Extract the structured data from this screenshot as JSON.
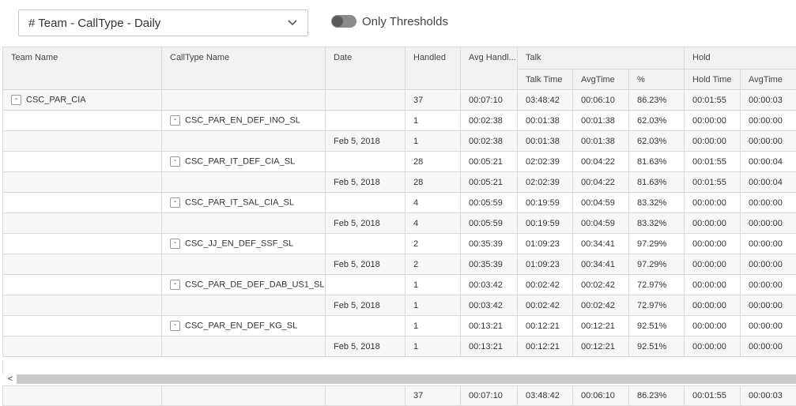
{
  "report_selector": {
    "value": "# Team - CallType - Daily"
  },
  "threshold_toggle": {
    "label": "Only Thresholds",
    "on": false
  },
  "table": {
    "headers": {
      "team_name": "Team Name",
      "calltype_name": "CallType Name",
      "date": "Date",
      "handled": "Handled",
      "avg_handle": "Avg Handl...",
      "talk_group": "Talk",
      "talk_time": "Talk Time",
      "talk_avgtime": "AvgTime",
      "talk_pct": "%",
      "hold_group": "Hold",
      "hold_time": "Hold Time",
      "hold_avgtime": "AvgTime"
    },
    "rows": [
      {
        "team": "CSC_PAR_CIA",
        "calltype": "",
        "date": "",
        "handled": "37",
        "avg_handle": "00:07:10",
        "talk_time": "03:48:42",
        "talk_avg": "00:06:10",
        "talk_pct": "86.23%",
        "hold_time": "00:01:55",
        "hold_avg": "00:00:03"
      },
      {
        "team": "",
        "calltype": "CSC_PAR_EN_DEF_INO_SL",
        "date": "",
        "handled": "1",
        "avg_handle": "00:02:38",
        "talk_time": "00:01:38",
        "talk_avg": "00:01:38",
        "talk_pct": "62.03%",
        "hold_time": "00:00:00",
        "hold_avg": "00:00:00"
      },
      {
        "team": "",
        "calltype": "",
        "date": "Feb 5, 2018",
        "handled": "1",
        "avg_handle": "00:02:38",
        "talk_time": "00:01:38",
        "talk_avg": "00:01:38",
        "talk_pct": "62.03%",
        "hold_time": "00:00:00",
        "hold_avg": "00:00:00"
      },
      {
        "team": "",
        "calltype": "CSC_PAR_IT_DEF_CIA_SL",
        "date": "",
        "handled": "28",
        "avg_handle": "00:05:21",
        "talk_time": "02:02:39",
        "talk_avg": "00:04:22",
        "talk_pct": "81.63%",
        "hold_time": "00:01:55",
        "hold_avg": "00:00:04"
      },
      {
        "team": "",
        "calltype": "",
        "date": "Feb 5, 2018",
        "handled": "28",
        "avg_handle": "00:05:21",
        "talk_time": "02:02:39",
        "talk_avg": "00:04:22",
        "talk_pct": "81.63%",
        "hold_time": "00:01:55",
        "hold_avg": "00:00:04"
      },
      {
        "team": "",
        "calltype": "CSC_PAR_IT_SAL_CIA_SL",
        "date": "",
        "handled": "4",
        "avg_handle": "00:05:59",
        "talk_time": "00:19:59",
        "talk_avg": "00:04:59",
        "talk_pct": "83.32%",
        "hold_time": "00:00:00",
        "hold_avg": "00:00:00"
      },
      {
        "team": "",
        "calltype": "",
        "date": "Feb 5, 2018",
        "handled": "4",
        "avg_handle": "00:05:59",
        "talk_time": "00:19:59",
        "talk_avg": "00:04:59",
        "talk_pct": "83.32%",
        "hold_time": "00:00:00",
        "hold_avg": "00:00:00"
      },
      {
        "team": "",
        "calltype": "CSC_JJ_EN_DEF_SSF_SL",
        "date": "",
        "handled": "2",
        "avg_handle": "00:35:39",
        "talk_time": "01:09:23",
        "talk_avg": "00:34:41",
        "talk_pct": "97.29%",
        "hold_time": "00:00:00",
        "hold_avg": "00:00:00"
      },
      {
        "team": "",
        "calltype": "",
        "date": "Feb 5, 2018",
        "handled": "2",
        "avg_handle": "00:35:39",
        "talk_time": "01:09:23",
        "talk_avg": "00:34:41",
        "talk_pct": "97.29%",
        "hold_time": "00:00:00",
        "hold_avg": "00:00:00"
      },
      {
        "team": "",
        "calltype": "CSC_PAR_DE_DEF_DAB_US1_SL",
        "date": "",
        "handled": "1",
        "avg_handle": "00:03:42",
        "talk_time": "00:02:42",
        "talk_avg": "00:02:42",
        "talk_pct": "72.97%",
        "hold_time": "00:00:00",
        "hold_avg": "00:00:00"
      },
      {
        "team": "",
        "calltype": "",
        "date": "Feb 5, 2018",
        "handled": "1",
        "avg_handle": "00:03:42",
        "talk_time": "00:02:42",
        "talk_avg": "00:02:42",
        "talk_pct": "72.97%",
        "hold_time": "00:00:00",
        "hold_avg": "00:00:00"
      },
      {
        "team": "",
        "calltype": "CSC_PAR_EN_DEF_KG_SL",
        "date": "",
        "handled": "1",
        "avg_handle": "00:13:21",
        "talk_time": "00:12:21",
        "talk_avg": "00:12:21",
        "talk_pct": "92.51%",
        "hold_time": "00:00:00",
        "hold_avg": "00:00:00"
      },
      {
        "team": "",
        "calltype": "",
        "date": "Feb 5, 2018",
        "handled": "1",
        "avg_handle": "00:13:21",
        "talk_time": "00:12:21",
        "talk_avg": "00:12:21",
        "talk_pct": "92.51%",
        "hold_time": "00:00:00",
        "hold_avg": "00:00:00"
      }
    ],
    "expander_symbol": "-",
    "totals": {
      "handled": "37",
      "avg_handle": "00:07:10",
      "talk_time": "03:48:42",
      "talk_avg": "00:06:10",
      "talk_pct": "86.23%",
      "hold_time": "00:01:55",
      "hold_avg": "00:00:03"
    }
  },
  "scroll_left_symbol": "<"
}
